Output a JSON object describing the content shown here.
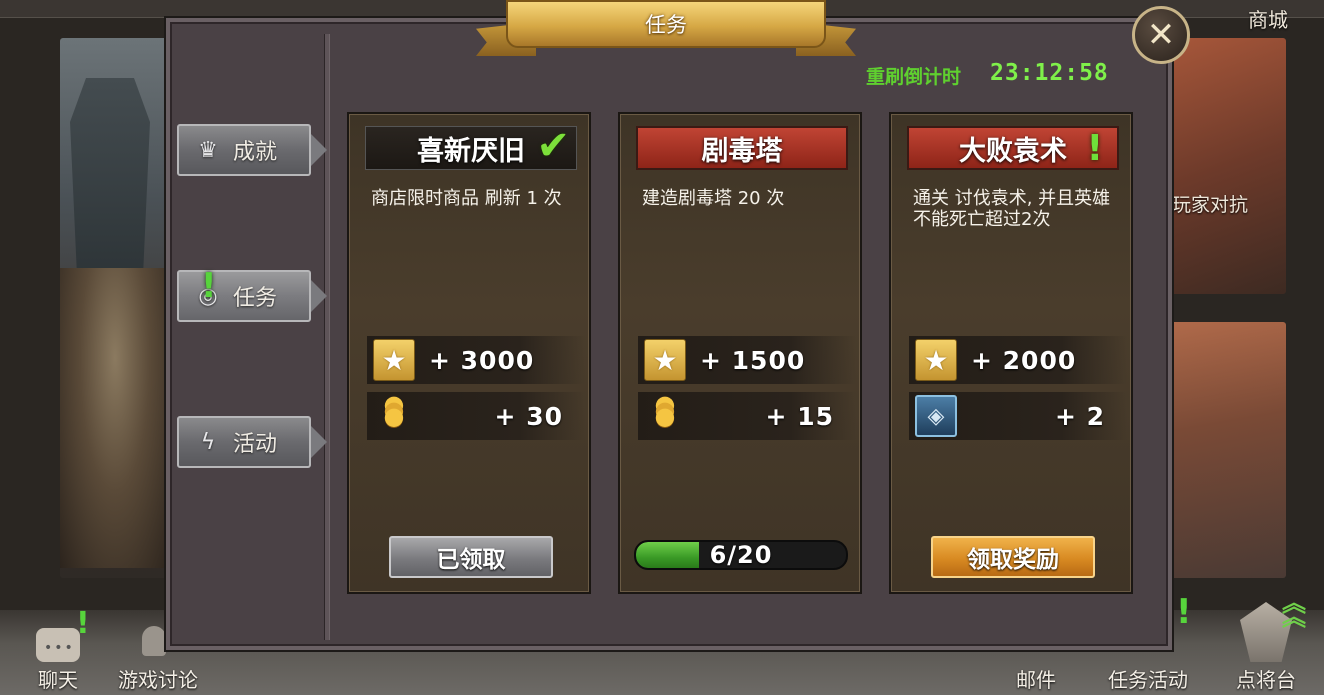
{
  "window": {
    "title": "任务"
  },
  "top_nav": {
    "shop_label": "商城"
  },
  "countdown": {
    "label": "重刷倒计时",
    "value": "23:12:58"
  },
  "tabs": [
    {
      "label": "成就",
      "icon": "crown-icon",
      "active": false,
      "alert": false
    },
    {
      "label": "任务",
      "icon": "scroll-icon",
      "active": true,
      "alert": true
    },
    {
      "label": "活动",
      "icon": "lightning-icon",
      "active": false,
      "alert": false
    }
  ],
  "cards": [
    {
      "title": "喜新厌旧",
      "state": "completed",
      "description": "商店限时商品 刷新 1 次",
      "rewards": [
        {
          "icon": "star-icon",
          "value": "+ 3000"
        },
        {
          "icon": "gold-coins-icon",
          "value": "+ 30"
        }
      ],
      "button_label": "已领取"
    },
    {
      "title": "剧毒塔",
      "state": "in-progress",
      "description": "建造剧毒塔 20 次",
      "rewards": [
        {
          "icon": "star-icon",
          "value": "+ 1500"
        },
        {
          "icon": "gold-coins-icon",
          "value": "+ 15"
        }
      ],
      "progress": {
        "current": 6,
        "total": 20,
        "label": "6/20"
      }
    },
    {
      "title": "大败袁术",
      "state": "claimable",
      "description": "通关 讨伐袁术, 并且英雄不能死亡超过2次",
      "rewards": [
        {
          "icon": "star-icon",
          "value": "+ 2000"
        },
        {
          "icon": "card-token-icon",
          "value": "+ 2"
        }
      ],
      "button_label": "领取奖励"
    }
  ],
  "background": {
    "right_card_text": "玩家对抗"
  },
  "bottom_bar": {
    "chat_label": "聊天",
    "discussion_label": "游戏讨论",
    "mail_label": "邮件",
    "task_activity_label": "任务活动",
    "generals_label": "点将台"
  },
  "colors": {
    "countdown_green": "#5fd02f",
    "title_red": "#c04434",
    "claim_orange": "#e8a036",
    "check_green": "#7ce03a",
    "panel_bg": "#4a4145"
  }
}
